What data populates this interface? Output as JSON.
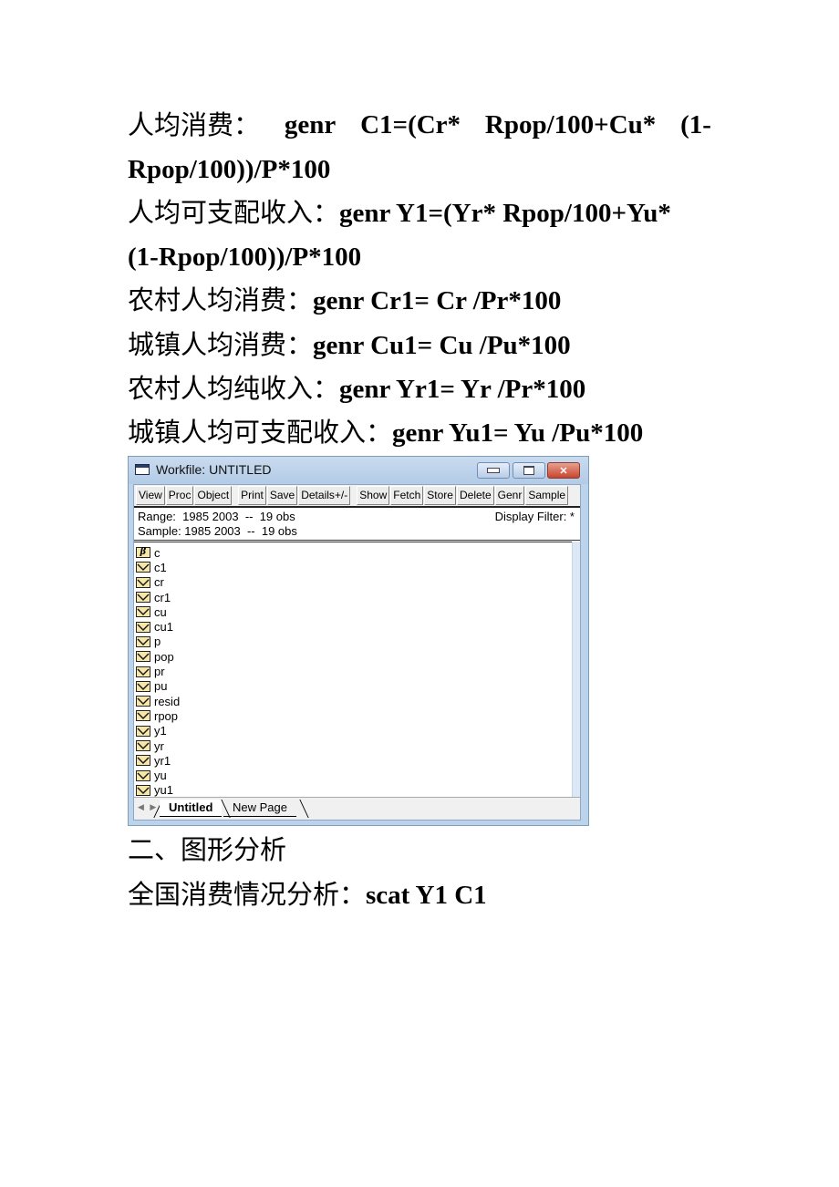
{
  "document": {
    "lines": [
      {
        "label": "人均消费：",
        "parts": [
          "genr",
          "C1=(Cr*",
          "Rpop/100+Cu*",
          "(1-"
        ]
      },
      {
        "text": "Rpop/100))/P*100"
      },
      {
        "label": "人均可支配收入：",
        "code": "genr Y1=(Yr* Rpop/100+Yu*"
      },
      {
        "text": "(1-Rpop/100))/P*100"
      },
      {
        "label": "农村人均消费：",
        "code": "genr Cr1= Cr /Pr*100"
      },
      {
        "label": "城镇人均消费：",
        "code": "genr Cu1= Cu /Pu*100"
      },
      {
        "label": "农村人均纯收入：",
        "code": "genr Yr1= Yr /Pr*100"
      },
      {
        "label": "城镇人均可支配收入：",
        "code": "genr Yu1= Yu /Pu*100"
      }
    ],
    "section_heading": "二、图形分析",
    "analysis": {
      "label": "全国消费情况分析：",
      "code": "scat Y1 C1"
    }
  },
  "workfile": {
    "title": "Workfile: UNTITLED",
    "window_buttons": {
      "minimize": "minimize",
      "maximize": "maximize",
      "close": "✕"
    },
    "toolbar": {
      "group1": [
        "View",
        "Proc",
        "Object"
      ],
      "group2": [
        "Print",
        "Save",
        "Details+/-"
      ],
      "group3": [
        "Show",
        "Fetch",
        "Store",
        "Delete",
        "Genr",
        "Sample"
      ]
    },
    "range": "Range:  1985 2003  --  19 obs",
    "sample": "Sample: 1985 2003  --  19 obs",
    "display_filter": "Display Filter: *",
    "objects": [
      {
        "name": "c",
        "icon": "coefficient-icon"
      },
      {
        "name": "c1",
        "icon": "series-icon"
      },
      {
        "name": "cr",
        "icon": "series-icon"
      },
      {
        "name": "cr1",
        "icon": "series-icon"
      },
      {
        "name": "cu",
        "icon": "series-icon"
      },
      {
        "name": "cu1",
        "icon": "series-icon"
      },
      {
        "name": "p",
        "icon": "series-icon"
      },
      {
        "name": "pop",
        "icon": "series-icon"
      },
      {
        "name": "pr",
        "icon": "series-icon"
      },
      {
        "name": "pu",
        "icon": "series-icon"
      },
      {
        "name": "resid",
        "icon": "series-icon"
      },
      {
        "name": "rpop",
        "icon": "series-icon"
      },
      {
        "name": "y1",
        "icon": "series-icon"
      },
      {
        "name": "yr",
        "icon": "series-icon"
      },
      {
        "name": "yr1",
        "icon": "series-icon"
      },
      {
        "name": "yu",
        "icon": "series-icon"
      },
      {
        "name": "yu1",
        "icon": "series-icon"
      }
    ],
    "tabs": {
      "active": "Untitled",
      "inactive": "New Page"
    },
    "coefficient_symbol": "β"
  }
}
